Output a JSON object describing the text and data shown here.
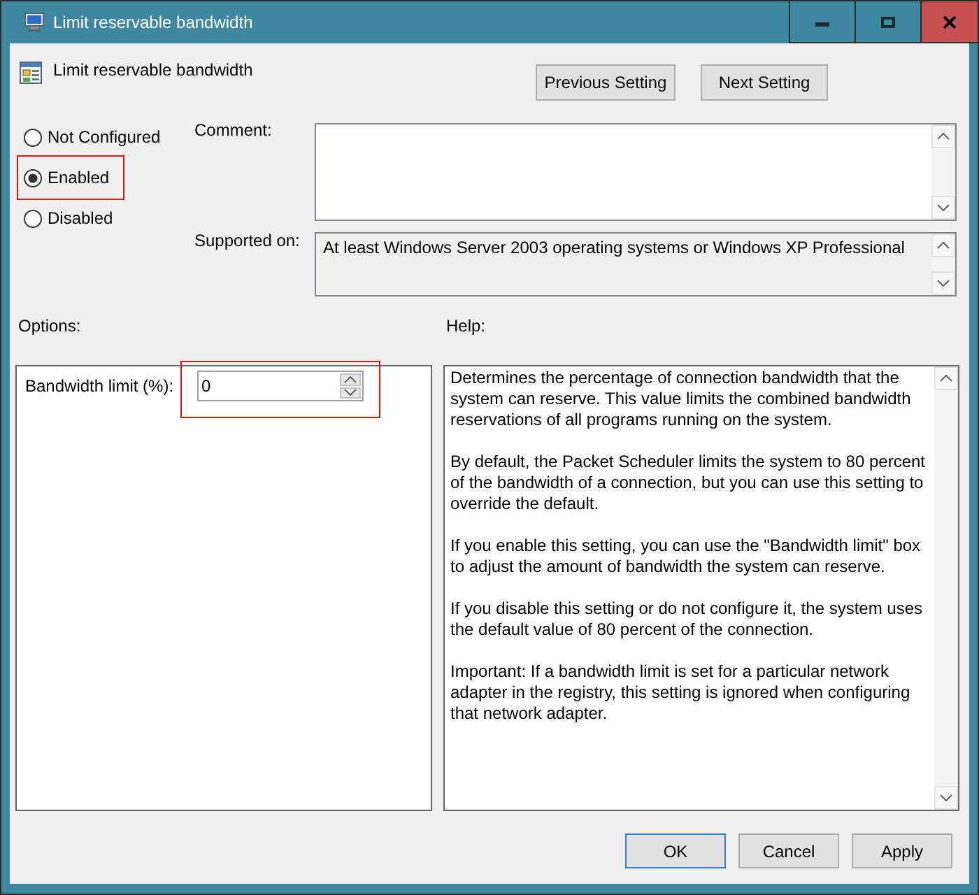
{
  "window": {
    "title": "Limit reservable bandwidth"
  },
  "header": {
    "title": "Limit reservable bandwidth",
    "nav_buttons": [
      {
        "label": "Previous Setting"
      },
      {
        "label": "Next Setting"
      }
    ]
  },
  "state_options": [
    {
      "label": "Not Configured",
      "selected": false,
      "highlighted": false
    },
    {
      "label": "Enabled",
      "selected": true,
      "highlighted": true
    },
    {
      "label": "Disabled",
      "selected": false,
      "highlighted": false
    }
  ],
  "comment": {
    "label": "Comment:"
  },
  "supported_on": {
    "label": "Supported on:",
    "value": "At least Windows Server 2003 operating systems or Windows XP Professional"
  },
  "options": {
    "label": "Options:",
    "fields": [
      {
        "label": "Bandwidth limit (%):",
        "value": "0",
        "highlighted": true
      }
    ]
  },
  "help": {
    "label": "Help:",
    "paragraphs": [
      "Determines the percentage of connection bandwidth that the system can reserve. This value limits the combined bandwidth reservations of all programs running on the system.",
      "By default, the Packet Scheduler limits the system to 80 percent of the bandwidth of a connection, but you can use this setting to override the default.",
      "If you enable this setting, you can use the \"Bandwidth limit\" box to adjust the amount of bandwidth the system can reserve.",
      "If you disable this setting or do not configure it, the system uses the default value of 80 percent of the connection.",
      "Important: If a bandwidth limit is set for a particular network adapter in the registry, this setting is ignored when configuring that network adapter."
    ]
  },
  "buttons": [
    {
      "label": "OK",
      "default": true
    },
    {
      "label": "Cancel",
      "default": false
    },
    {
      "label": "Apply",
      "default": false
    }
  ]
}
